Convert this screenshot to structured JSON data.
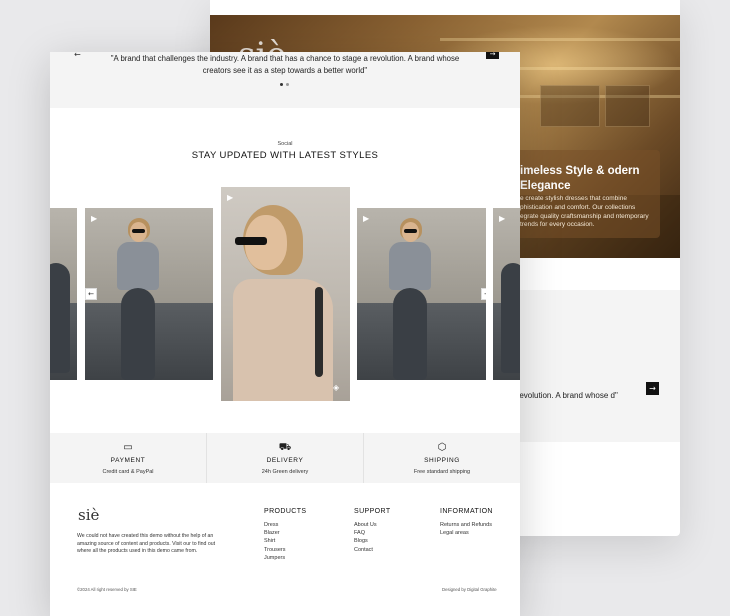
{
  "back_page": {
    "hero_logo": "siè",
    "hero_title": "imeless Style & odern Elegance",
    "hero_desc": "e create stylish dresses that combine phistication and comfort. Our collections egrate quality craftsmanship and ntemporary trends for every occasion.",
    "quote_fragment": "a revolution. A brand whose d\"",
    "arrow": "→"
  },
  "testimonial": {
    "quote": "\"A brand that challenges the industry. A brand that has a chance to stage a revolution. A brand whose creators see it as a step towards a better world\"",
    "prev": "←",
    "next": "→"
  },
  "social": {
    "label": "Social",
    "title": "STAY UPDATED WITH LATEST STYLES",
    "play": "▶",
    "prev": "←",
    "next": "→",
    "mute": "◈"
  },
  "features": [
    {
      "icon": "▭",
      "title": "PAYMENT",
      "sub": "Credit card & PayPal"
    },
    {
      "icon": "⛟",
      "title": "DELIVERY",
      "sub": "24h Green delivery"
    },
    {
      "icon": "⬡",
      "title": "SHIPPING",
      "sub": "Free standard shipping"
    }
  ],
  "footer": {
    "logo": "siè",
    "about": "We could not have created this demo without the help of an amazing source of content and products. Visit our to find out where all the products used in this demo came from.",
    "products_title": "PRODUCTS",
    "products": [
      "Dress",
      "Blazer",
      "Shirt",
      "Trousers",
      "Jumpers"
    ],
    "support_title": "SUPPORT",
    "support": [
      "About Us",
      "FAQ",
      "Blogs",
      "Contact"
    ],
    "information_title": "INFORMATION",
    "information": [
      "Returns and Refunds",
      "Legal areas"
    ],
    "copyright": "©2024 All right reserved by SIE",
    "designed": "Designed by Digital Graphite"
  }
}
